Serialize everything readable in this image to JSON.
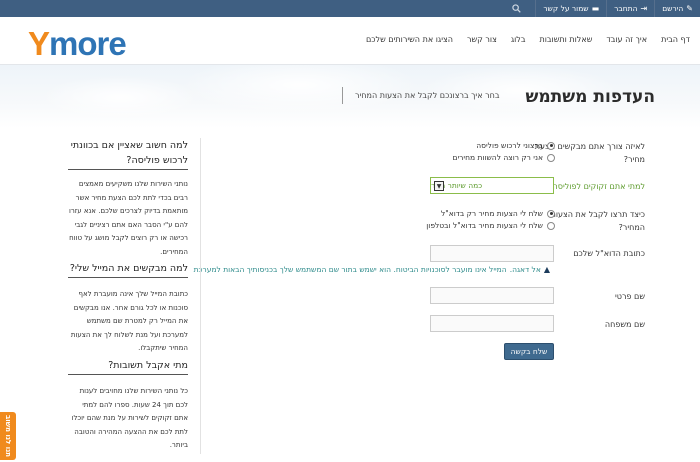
{
  "topbar": {
    "register": "הירשם",
    "login": "התחבר",
    "contact": "שמור על קשר"
  },
  "logo": {
    "y": "Y",
    "more": "more"
  },
  "nav": [
    "דף הבית",
    "איך זה עובד",
    "שאלות ותשובות",
    "בלוג",
    "צור קשר",
    "הציגו את השירותים שלכם"
  ],
  "hero": {
    "title": "העדפות משתמש",
    "subtitle": "בחר איך ברצונכם לקבל את הצעות המחיר"
  },
  "form": {
    "q1_label": "לאיזה צורך אתם מבקשים הצעת מחיר?",
    "q1_options": [
      "ברצוני לרכוש פוליסה",
      "אני רק רוצה להשוות מחירים"
    ],
    "q2_label": "למתי אתם זקוקים לפוליסה?",
    "q2_select_value": "כמה שיותר מהר",
    "q3_label": "כיצד תרצו לקבל את הצעות המחיר?",
    "q3_options": [
      "שלח לי הצעות מחיר רק בדוא\"ל",
      "שלח לי הצעות מחיר בדוא\"ל ובטלפון"
    ],
    "email_label": "כתובת הדוא\"ל שלכם",
    "notice_strong": "אל דאגה.",
    "notice_text": "המייל אינו מועבר לסוכנויות הביטוח. הוא ישמש בתור שם המשתמש שלך בכניסותיך הבאות למערכת",
    "first_name_label": "שם פרטי",
    "last_name_label": "שם משפחה",
    "submit_label": "שלח בקשה"
  },
  "sidebar": {
    "h1": "למה חשוב שאציין אם בכוונתי לרכוש פוליסה?",
    "p1": "נותני השירות שלנו משקיעים מאמצים רבים בכדי לתת לכם הצעת מחיר אשר מותאמת בדיוק לצרכים שלכם. אנא עזרו להם ע\"י הסבר האם אתם רציניים לגבי רכישה או רק רוצים לקבל מושג על טווח המחירים.",
    "h2": "למה מבקשים את המייל שלי?",
    "p2": "כתובת המייל שלך אינה מועברת לאף סוכנות או לכל גורם אחר. אנו מבקשים את המייל רק למטרת שם משתמש למערכת ועל מנת לשלוח לך את הצעות המחיר שיתקבלו.",
    "h3": "מתי אקבל תשובות?",
    "p3": "כל נותני השירות שלנו מחויבים לענות לכם תוך 24 שעות. ספרו להם למתי אתם זקוקים לשירות על מנת שהם יוכלו לתת לכם את ההצעה המהירה והטובה ביותר."
  },
  "feedback_tab": "תנו לנו משוב"
}
